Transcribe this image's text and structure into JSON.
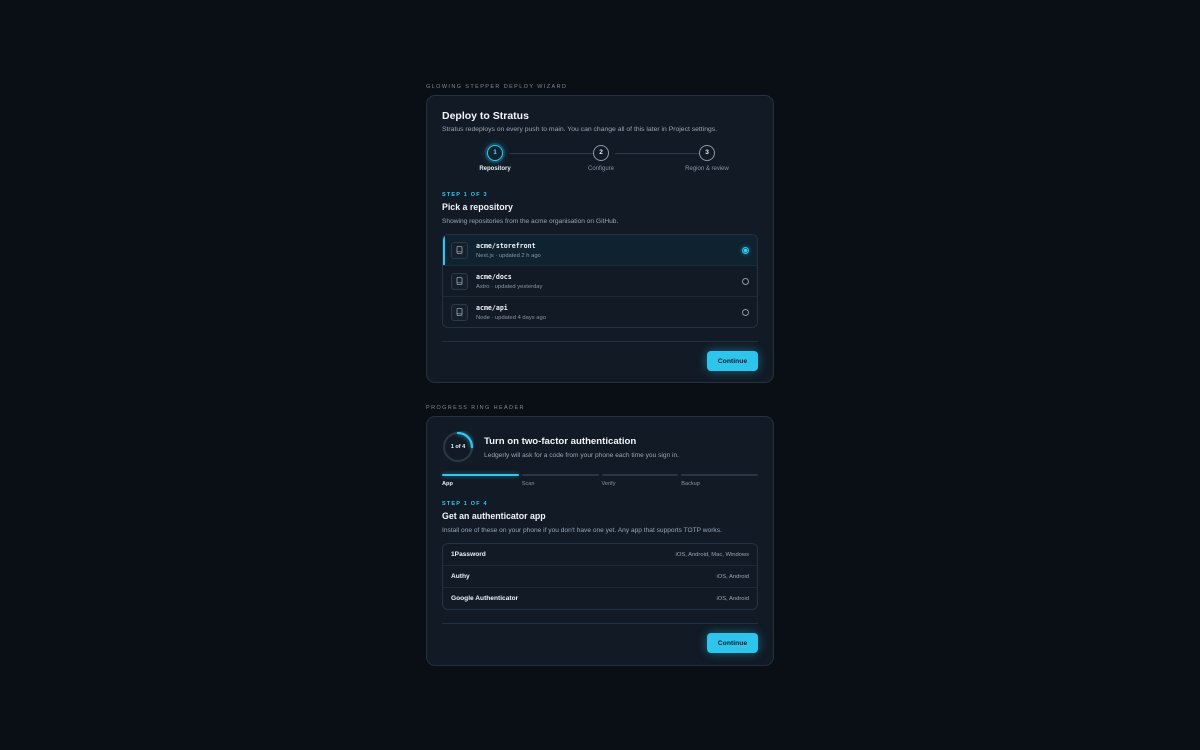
{
  "deploy_section": {
    "label": "Glowing Stepper Deploy Wizard",
    "title": "Deploy to Stratus",
    "subtitle": "Stratus redeploys on every push to main. You can change all of this later in Project settings.",
    "steps": [
      {
        "number": "1",
        "label": "Repository",
        "state": "active"
      },
      {
        "number": "2",
        "label": "Configure",
        "state": "pending"
      },
      {
        "number": "3",
        "label": "Region & review",
        "state": "pending"
      }
    ],
    "eyebrow": "Step 1 of 3",
    "heading": "Pick a repository",
    "description": "Showing repositories from the acme organisation on GitHub.",
    "repos": [
      {
        "name": "acme/storefront",
        "meta": "Next.js · updated 2 h ago",
        "selected": true,
        "icon": "repo-icon"
      },
      {
        "name": "acme/docs",
        "meta": "Astro · updated yesterday",
        "selected": false,
        "icon": "repo-icon"
      },
      {
        "name": "acme/api",
        "meta": "Node · updated 4 days ago",
        "selected": false,
        "icon": "repo-icon"
      }
    ],
    "continue_label": "Continue"
  },
  "twofa_section": {
    "label": "Progress Ring Header",
    "ring_text": "1 of 4",
    "ring_progress": 0.25,
    "title": "Turn on two-factor authentication",
    "subtitle": "Ledgerly will ask for a code from your phone each time you sign in.",
    "segments": [
      {
        "label": "App",
        "active": true
      },
      {
        "label": "Scan",
        "active": false
      },
      {
        "label": "Verify",
        "active": false
      },
      {
        "label": "Backup",
        "active": false
      }
    ],
    "eyebrow": "Step 1 of 4",
    "heading": "Get an authenticator app",
    "description": "Install one of these on your phone if you don't have one yet. Any app that supports TOTP works.",
    "apps": [
      {
        "name": "1Password",
        "platforms": "iOS, Android, Mac, Windows"
      },
      {
        "name": "Authy",
        "platforms": "iOS, Android"
      },
      {
        "name": "Google Authenticator",
        "platforms": "iOS, Android"
      }
    ],
    "continue_label": "Continue"
  },
  "colors": {
    "accent": "#34c6ee",
    "background": "#0a0e15",
    "card": "#111a25"
  }
}
